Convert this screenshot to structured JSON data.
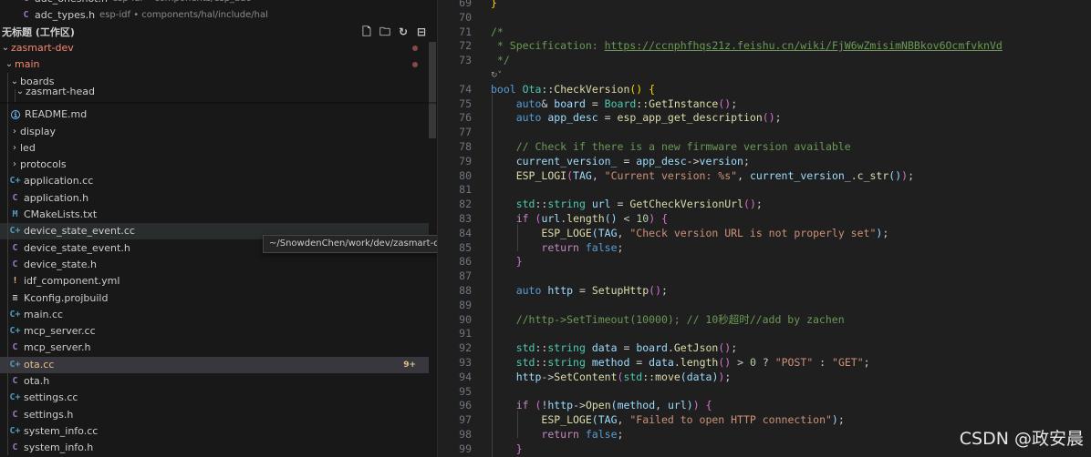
{
  "explorer": {
    "open_editors": [
      {
        "name": "adc_oneshot.h",
        "path": "esp-idf • components/esp_adc",
        "kind": "h"
      },
      {
        "name": "adc_types.h",
        "path": "esp-idf • components/hal/include/hal",
        "kind": "h"
      }
    ],
    "workspace_title": "无标题 (工作区)",
    "toolbar": [
      "new-file-icon",
      "new-folder-icon",
      "refresh-icon",
      "collapse-all-icon"
    ],
    "tree": [
      {
        "name": "zasmart-dev",
        "type": "folder",
        "expanded": true,
        "level": 0,
        "dot": true
      },
      {
        "name": "main",
        "type": "folder",
        "expanded": true,
        "level": 1,
        "dot": true
      },
      {
        "name": "boards",
        "type": "folder",
        "expanded": true,
        "level": 2
      },
      {
        "name": "zasmart-head",
        "type": "folder",
        "expanded": true,
        "level": 3
      },
      {
        "name": "README.md",
        "type": "info",
        "level": 2
      },
      {
        "name": "display",
        "type": "folder",
        "expanded": false,
        "level": 2
      },
      {
        "name": "led",
        "type": "folder",
        "expanded": false,
        "level": 2
      },
      {
        "name": "protocols",
        "type": "folder",
        "expanded": false,
        "level": 2
      },
      {
        "name": "application.cc",
        "type": "cc",
        "level": 1
      },
      {
        "name": "application.h",
        "type": "h",
        "level": 1
      },
      {
        "name": "CMakeLists.txt",
        "type": "m",
        "level": 1
      },
      {
        "name": "device_state_event.cc",
        "type": "cc",
        "level": 1,
        "hovered": true
      },
      {
        "name": "device_state_event.h",
        "type": "h",
        "level": 1
      },
      {
        "name": "device_state.h",
        "type": "h",
        "level": 1
      },
      {
        "name": "idf_component.yml",
        "type": "yml",
        "level": 1
      },
      {
        "name": "Kconfig.projbuild",
        "type": "k",
        "level": 1
      },
      {
        "name": "main.cc",
        "type": "cc",
        "level": 1
      },
      {
        "name": "mcp_server.cc",
        "type": "cc",
        "level": 1
      },
      {
        "name": "mcp_server.h",
        "type": "h",
        "level": 1
      },
      {
        "name": "ota.cc",
        "type": "cc",
        "level": 1,
        "selected": true,
        "badge": "9+"
      },
      {
        "name": "ota.h",
        "type": "h",
        "level": 1
      },
      {
        "name": "settings.cc",
        "type": "cc",
        "level": 1
      },
      {
        "name": "settings.h",
        "type": "h",
        "level": 1
      },
      {
        "name": "system_info.cc",
        "type": "cc",
        "level": 1
      },
      {
        "name": "system_info.h",
        "type": "h",
        "level": 1
      }
    ],
    "tooltip": "~/SnowdenChen/work/dev/zasmart-dev/main/device_state_event.cc"
  },
  "editor": {
    "lines": [
      {
        "n": "69",
        "code": "<span class=\"y\">}</span>"
      },
      {
        "n": "70",
        "code": ""
      },
      {
        "n": "71",
        "code": "<span class=\"c\">/*</span>"
      },
      {
        "n": "72",
        "code": "<span class=\"c\"> * Specification: </span><span class=\"u\">https://ccnphfhqs21z.feishu.cn/wiki/FjW6wZmisimNBBkov6OcmfvknVd</span>"
      },
      {
        "n": "73",
        "code": "<span class=\"c\"> */</span>"
      },
      {
        "lens": "↻˅"
      },
      {
        "n": "74",
        "code": "<span class=\"k\">bool</span> <span class=\"t\">Ota</span>::<span class=\"f\">CheckVersion</span><span class=\"y\">()</span> <span class=\"y\">{</span>"
      },
      {
        "n": "75",
        "code": "    <span class=\"k\">auto</span>&amp; <span class=\"v\">board</span> = <span class=\"t\">Board</span>::<span class=\"f\">GetInstance</span><span class=\"p\">()</span>;"
      },
      {
        "n": "76",
        "code": "    <span class=\"k\">auto</span> <span class=\"v\">app_desc</span> = <span class=\"f\">esp_app_get_description</span><span class=\"p\">()</span>;"
      },
      {
        "n": "77",
        "code": ""
      },
      {
        "n": "78",
        "code": "    <span class=\"c\">// Check if there is a new firmware version available</span>"
      },
      {
        "n": "79",
        "code": "    <span class=\"v\">current_version_</span> = <span class=\"v\">app_desc</span>-&gt;<span class=\"v\">version</span>;"
      },
      {
        "n": "80",
        "code": "    <span class=\"f\">ESP_LOGI</span><span class=\"p\">(</span><span class=\"v\">TAG</span>, <span class=\"s\">\"Current version: %s\"</span>, <span class=\"v\">current_version_</span>.<span class=\"f\">c_str</span><span class=\"v\">()</span><span class=\"p\">)</span>;"
      },
      {
        "n": "81",
        "code": ""
      },
      {
        "n": "82",
        "code": "    <span class=\"t\">std</span>::<span class=\"t\">string</span> <span class=\"v\">url</span> = <span class=\"f\">GetCheckVersionUrl</span><span class=\"p\">()</span>;"
      },
      {
        "n": "83",
        "code": "    <span class=\"m\">if</span> <span class=\"p\">(</span><span class=\"v\">url</span>.<span class=\"f\">length</span><span class=\"v\">()</span> &lt; <span class=\"n\">10</span><span class=\"p\">)</span> <span class=\"p\">{</span>"
      },
      {
        "n": "84",
        "code": "        <span class=\"f\">ESP_LOGE</span><span class=\"v\">(</span><span class=\"v\">TAG</span>, <span class=\"s\">\"Check version URL is not properly set\"</span><span class=\"v\">)</span>;"
      },
      {
        "n": "85",
        "code": "        <span class=\"m\">return</span> <span class=\"k\">false</span>;"
      },
      {
        "n": "86",
        "code": "    <span class=\"p\">}</span>"
      },
      {
        "n": "87",
        "code": ""
      },
      {
        "n": "88",
        "code": "    <span class=\"k\">auto</span> <span class=\"v\">http</span> = <span class=\"f\">SetupHttp</span><span class=\"p\">()</span>;"
      },
      {
        "n": "89",
        "code": ""
      },
      {
        "n": "90",
        "code": "    <span class=\"c\">//http-&gt;SetTimeout(10000); // 10秒超时//add by zachen</span>"
      },
      {
        "n": "91",
        "code": ""
      },
      {
        "n": "92",
        "code": "    <span class=\"t\">std</span>::<span class=\"t\">string</span> <span class=\"v\">data</span> = <span class=\"v\">board</span>.<span class=\"f\">GetJson</span><span class=\"p\">()</span>;"
      },
      {
        "n": "93",
        "code": "    <span class=\"t\">std</span>::<span class=\"t\">string</span> <span class=\"v\">method</span> = <span class=\"v\">data</span>.<span class=\"f\">length</span><span class=\"p\">()</span> &gt; <span class=\"n\">0</span> ? <span class=\"s\">\"POST\"</span> : <span class=\"s\">\"GET\"</span>;"
      },
      {
        "n": "94",
        "code": "    <span class=\"v\">http</span>-&gt;<span class=\"f\">SetContent</span><span class=\"p\">(</span><span class=\"t\">std</span>::<span class=\"f\">move</span><span class=\"v\">(</span><span class=\"v\">data</span><span class=\"v\">)</span><span class=\"p\">)</span>;"
      },
      {
        "n": "95",
        "code": ""
      },
      {
        "n": "96",
        "code": "    <span class=\"m\">if</span> <span class=\"p\">(</span>!<span class=\"v\">http</span>-&gt;<span class=\"f\">Open</span><span class=\"v\">(</span><span class=\"v\">method</span>, <span class=\"v\">url</span><span class=\"v\">)</span><span class=\"p\">)</span> <span class=\"p\">{</span>"
      },
      {
        "n": "97",
        "code": "        <span class=\"f\">ESP_LOGE</span><span class=\"v\">(</span><span class=\"v\">TAG</span>, <span class=\"s\">\"Failed to open HTTP connection\"</span><span class=\"v\">)</span>;"
      },
      {
        "n": "98",
        "code": "        <span class=\"m\">return</span> <span class=\"k\">false</span>;"
      },
      {
        "n": "99",
        "code": "    <span class=\"p\">}</span>"
      }
    ]
  },
  "watermark": "CSDN @政安晨",
  "colors": {
    "sidebar_bg": "#181818",
    "editor_bg": "#1f1f1f",
    "selected_row": "#37373d",
    "modified": "#e2c08d"
  }
}
